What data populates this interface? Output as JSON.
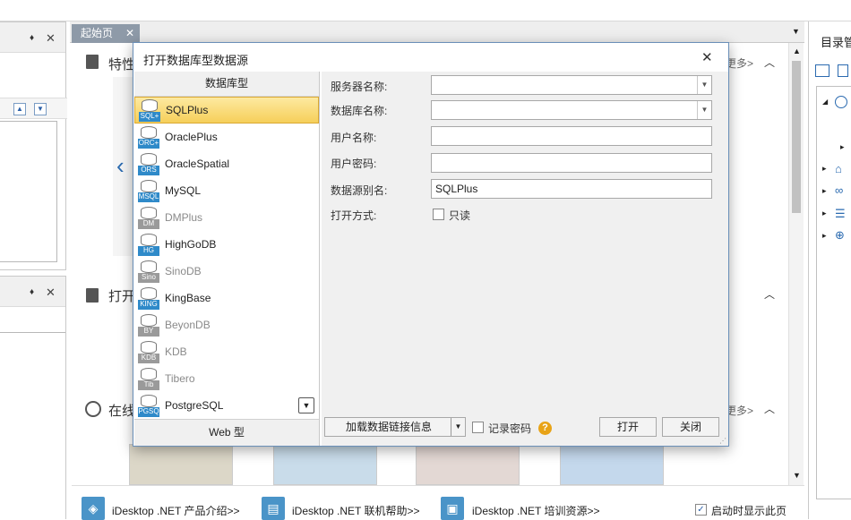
{
  "left_dock": {
    "panel1": {
      "pin": "♦",
      "close": "✕"
    },
    "panel2": {
      "pin": "♦",
      "close": "✕"
    }
  },
  "start_page": {
    "tab_label": "起始页",
    "tab_close": "✕",
    "sections": [
      {
        "title": "特性",
        "more": ""
      },
      {
        "title": "打开",
        "more": ""
      },
      {
        "title": "在线",
        "more": "更多>"
      }
    ],
    "top_more": "更多>"
  },
  "footer": {
    "links": [
      {
        "label": "iDesktop .NET 产品介绍>>"
      },
      {
        "label": "iDesktop .NET 联机帮助>>"
      },
      {
        "label": "iDesktop .NET 培训资源>>"
      }
    ],
    "show_on_start": "启动时显示此页",
    "show_on_start_checked": true
  },
  "right_dock": {
    "title": "目录管"
  },
  "dialog": {
    "title": "打开数据库型数据源",
    "close": "✕",
    "list_header": "数据库型",
    "items": [
      {
        "label": "SQLPlus",
        "tag": "SQL+",
        "enabled": true,
        "selected": true
      },
      {
        "label": "OraclePlus",
        "tag": "ORC+",
        "enabled": true,
        "selected": false
      },
      {
        "label": "OracleSpatial",
        "tag": "ORS",
        "enabled": true,
        "selected": false
      },
      {
        "label": "MySQL",
        "tag": "MSQL",
        "enabled": true,
        "selected": false
      },
      {
        "label": "DMPlus",
        "tag": "DM",
        "enabled": false,
        "selected": false
      },
      {
        "label": "HighGoDB",
        "tag": "HG",
        "enabled": true,
        "selected": false
      },
      {
        "label": "SinoDB",
        "tag": "Sino",
        "enabled": false,
        "selected": false
      },
      {
        "label": "KingBase",
        "tag": "KING",
        "enabled": true,
        "selected": false
      },
      {
        "label": "BeyonDB",
        "tag": "BY",
        "enabled": false,
        "selected": false
      },
      {
        "label": "KDB",
        "tag": "KDB",
        "enabled": false,
        "selected": false
      },
      {
        "label": "Tibero",
        "tag": "Tib",
        "enabled": false,
        "selected": false
      },
      {
        "label": "PostgreSQL",
        "tag": "PGSQ",
        "enabled": true,
        "selected": false
      }
    ],
    "web_tab": "Web 型",
    "form": {
      "server_label": "服务器名称:",
      "server_value": "",
      "database_label": "数据库名称:",
      "database_value": "",
      "user_label": "用户名称:",
      "user_value": "",
      "password_label": "用户密码:",
      "password_value": "",
      "alias_label": "数据源别名:",
      "alias_value": "SQLPlus",
      "open_mode_label": "打开方式:",
      "readonly_label": "只读",
      "readonly_checked": false
    },
    "buttons": {
      "load_link": "加载数据链接信息",
      "remember_password": "记录密码",
      "help": "?",
      "open": "打开",
      "close": "关闭"
    }
  }
}
